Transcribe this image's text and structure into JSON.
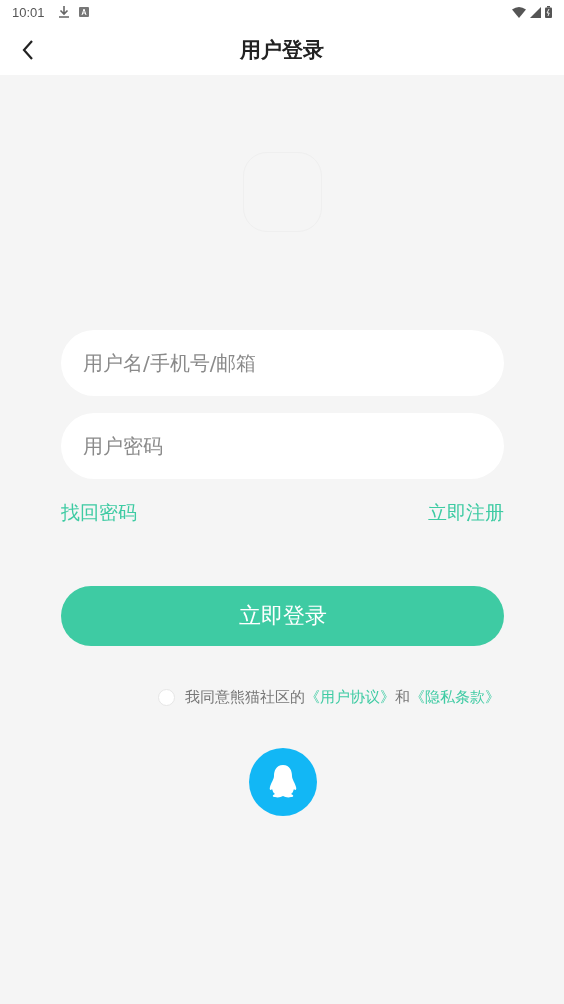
{
  "status_bar": {
    "time": "10:01"
  },
  "header": {
    "title": "用户登录"
  },
  "form": {
    "fields": [
      {
        "placeholder": "用户名/手机号/邮箱"
      },
      {
        "placeholder": "用户密码"
      }
    ],
    "links": [
      "找回密码",
      "立即注册"
    ],
    "submit": "立即登录"
  },
  "agreement": {
    "checked": false,
    "text": "我同意熊猫社区的",
    "link_1": "《用户协议》",
    "conjunction": "和",
    "link_2": "《隐私条款》"
  }
}
